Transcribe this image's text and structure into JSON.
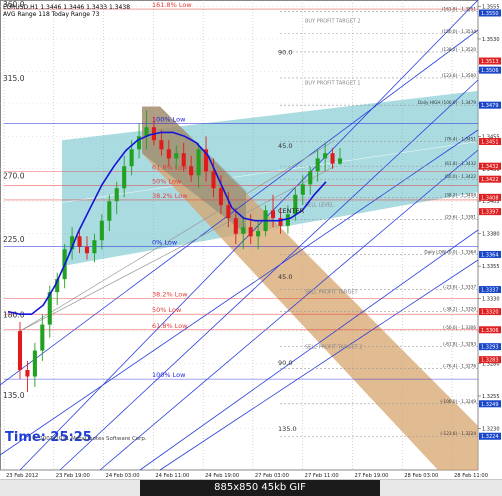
{
  "header": {
    "line1": "EURUSD,H1  1.3446 1.3446 1.3433 1.3438",
    "line2": "AVG Range 118   Today Range 73"
  },
  "footer": {
    "timer": "Time: 25:25",
    "copyright": "© 2001-2011 MetaQuotes Software Corp.",
    "image_caption": "885x850  45kb  GIF"
  },
  "colors": {
    "candle_up": "#21a121",
    "candle_down": "#e01b1b",
    "ma_line": "#1414d9",
    "up_channel": "#64bec8",
    "down_channel": "#d7a46e",
    "fib_red": "#e83a3a",
    "fib_gray": "#8c8c8c",
    "blue_label": "#2222dd",
    "price_tag_blue": "#1a47c9",
    "price_tag_red": "#e02020"
  },
  "chart_data": {
    "type": "candlestick",
    "symbol": "EURUSD",
    "timeframe": "H1",
    "ylim": [
      1.3198,
      1.356
    ],
    "x_ticks": [
      "23 Feb 2012",
      "23 Feb 19:00",
      "24 Feb 03:00",
      "24 Feb 11:00",
      "24 Feb 19:00",
      "27 Feb 03:00",
      "27 Feb 11:00",
      "27 Feb 19:00",
      "28 Feb 03:00",
      "28 Feb 11:00"
    ],
    "y_ticks": [
      "1.3555",
      "1.3530",
      "1.3505",
      "1.3480",
      "1.3455",
      "1.3430",
      "1.3405",
      "1.3380",
      "1.3355",
      "1.3330",
      "1.3305",
      "1.3280",
      "1.3255",
      "1.3230"
    ],
    "series": [
      {
        "name": "EURUSD",
        "values": [
          {
            "x": 0,
            "o": 1.3305,
            "h": 1.3312,
            "l": 1.3268,
            "c": 1.3275
          },
          {
            "x": 1,
            "o": 1.3275,
            "h": 1.3282,
            "l": 1.3258,
            "c": 1.327
          },
          {
            "x": 2,
            "o": 1.327,
            "h": 1.3296,
            "l": 1.3262,
            "c": 1.329
          },
          {
            "x": 3,
            "o": 1.329,
            "h": 1.3318,
            "l": 1.3282,
            "c": 1.331
          },
          {
            "x": 4,
            "o": 1.331,
            "h": 1.334,
            "l": 1.33,
            "c": 1.3335
          },
          {
            "x": 5,
            "o": 1.3335,
            "h": 1.335,
            "l": 1.3325,
            "c": 1.3345
          },
          {
            "x": 6,
            "o": 1.3345,
            "h": 1.3372,
            "l": 1.3338,
            "c": 1.3368
          },
          {
            "x": 7,
            "o": 1.3368,
            "h": 1.3385,
            "l": 1.336,
            "c": 1.3378
          },
          {
            "x": 8,
            "o": 1.3378,
            "h": 1.3382,
            "l": 1.3365,
            "c": 1.337
          },
          {
            "x": 9,
            "o": 1.337,
            "h": 1.3378,
            "l": 1.336,
            "c": 1.3365
          },
          {
            "x": 10,
            "o": 1.3365,
            "h": 1.338,
            "l": 1.3358,
            "c": 1.3375
          },
          {
            "x": 11,
            "o": 1.3375,
            "h": 1.3395,
            "l": 1.3368,
            "c": 1.339
          },
          {
            "x": 12,
            "o": 1.339,
            "h": 1.341,
            "l": 1.3382,
            "c": 1.3405
          },
          {
            "x": 13,
            "o": 1.3405,
            "h": 1.342,
            "l": 1.3395,
            "c": 1.3415
          },
          {
            "x": 14,
            "o": 1.3415,
            "h": 1.344,
            "l": 1.3408,
            "c": 1.3432
          },
          {
            "x": 15,
            "o": 1.3432,
            "h": 1.3452,
            "l": 1.3425,
            "c": 1.3445
          },
          {
            "x": 16,
            "o": 1.3445,
            "h": 1.3465,
            "l": 1.3438,
            "c": 1.3455
          },
          {
            "x": 17,
            "o": 1.3455,
            "h": 1.3475,
            "l": 1.3445,
            "c": 1.3462
          },
          {
            "x": 18,
            "o": 1.3462,
            "h": 1.347,
            "l": 1.3448,
            "c": 1.3452
          },
          {
            "x": 19,
            "o": 1.3452,
            "h": 1.346,
            "l": 1.344,
            "c": 1.3445
          },
          {
            "x": 20,
            "o": 1.3445,
            "h": 1.3452,
            "l": 1.3432,
            "c": 1.3438
          },
          {
            "x": 21,
            "o": 1.3438,
            "h": 1.3448,
            "l": 1.343,
            "c": 1.3442
          },
          {
            "x": 22,
            "o": 1.3442,
            "h": 1.345,
            "l": 1.3428,
            "c": 1.3432
          },
          {
            "x": 23,
            "o": 1.3432,
            "h": 1.344,
            "l": 1.342,
            "c": 1.3425
          },
          {
            "x": 24,
            "o": 1.3425,
            "h": 1.345,
            "l": 1.3415,
            "c": 1.3445
          },
          {
            "x": 25,
            "o": 1.3445,
            "h": 1.3455,
            "l": 1.342,
            "c": 1.3428
          },
          {
            "x": 26,
            "o": 1.3428,
            "h": 1.3438,
            "l": 1.3408,
            "c": 1.3415
          },
          {
            "x": 27,
            "o": 1.3415,
            "h": 1.3425,
            "l": 1.3395,
            "c": 1.3402
          },
          {
            "x": 28,
            "o": 1.3402,
            "h": 1.3412,
            "l": 1.3385,
            "c": 1.3392
          },
          {
            "x": 29,
            "o": 1.3392,
            "h": 1.34,
            "l": 1.3372,
            "c": 1.338
          },
          {
            "x": 30,
            "o": 1.338,
            "h": 1.3392,
            "l": 1.3368,
            "c": 1.3385
          },
          {
            "x": 31,
            "o": 1.3385,
            "h": 1.3395,
            "l": 1.3372,
            "c": 1.3378
          },
          {
            "x": 32,
            "o": 1.3378,
            "h": 1.339,
            "l": 1.3368,
            "c": 1.3382
          },
          {
            "x": 33,
            "o": 1.3382,
            "h": 1.3402,
            "l": 1.3378,
            "c": 1.3398
          },
          {
            "x": 34,
            "o": 1.3398,
            "h": 1.341,
            "l": 1.3385,
            "c": 1.3392
          },
          {
            "x": 35,
            "o": 1.3392,
            "h": 1.34,
            "l": 1.338,
            "c": 1.3386
          },
          {
            "x": 36,
            "o": 1.3386,
            "h": 1.3402,
            "l": 1.338,
            "c": 1.3395
          },
          {
            "x": 37,
            "o": 1.3395,
            "h": 1.3415,
            "l": 1.339,
            "c": 1.341
          },
          {
            "x": 38,
            "o": 1.341,
            "h": 1.3425,
            "l": 1.3402,
            "c": 1.3418
          },
          {
            "x": 39,
            "o": 1.3418,
            "h": 1.3432,
            "l": 1.341,
            "c": 1.3428
          },
          {
            "x": 40,
            "o": 1.3428,
            "h": 1.3445,
            "l": 1.342,
            "c": 1.3438
          },
          {
            "x": 41,
            "o": 1.3438,
            "h": 1.345,
            "l": 1.3428,
            "c": 1.3442
          },
          {
            "x": 42,
            "o": 1.3442,
            "h": 1.3446,
            "l": 1.343,
            "c": 1.3434
          },
          {
            "x": 43,
            "o": 1.3434,
            "h": 1.3446,
            "l": 1.3433,
            "c": 1.3438
          }
        ]
      },
      {
        "name": "MA",
        "values": [
          1.332,
          1.3318,
          1.3318,
          1.3325,
          1.334,
          1.336,
          1.3382,
          1.34,
          1.3418,
          1.3432,
          1.3444,
          1.3452,
          1.3456,
          1.3458,
          1.3458,
          1.3455,
          1.345,
          1.344,
          1.342,
          1.34,
          1.3392,
          1.339,
          1.339,
          1.339,
          1.3392,
          1.3398,
          1.341,
          1.342
        ]
      }
    ],
    "fib_levels_down": [
      {
        "label": "100% Low",
        "value": 1.3465,
        "color": "blue"
      },
      {
        "label": "61.8% Low",
        "value": 1.3428
      },
      {
        "label": "50% Low",
        "value": 1.3417
      },
      {
        "label": "38.2% Low",
        "value": 1.3406
      },
      {
        "label": "0% Low",
        "value": 1.337,
        "color": "blue"
      },
      {
        "label": "38.2% Low",
        "value": 1.333
      },
      {
        "label": "50% Low",
        "value": 1.3318
      },
      {
        "label": "61.8% Low",
        "value": 1.3306
      },
      {
        "label": "100% Low",
        "value": 1.3268,
        "color": "blue"
      },
      {
        "label": "161.8% Low",
        "value": 1.3553
      }
    ],
    "right_levels": [
      {
        "label": "(161.8) - 1.3551",
        "value": 1.3551
      },
      {
        "label": "(150.0) - 1.3534",
        "value": 1.3534
      },
      {
        "label": "(138.2) - 1.3520",
        "value": 1.352
      },
      {
        "label": "(123.6) - 1.3500",
        "value": 1.35
      },
      {
        "label": "Daily HIGH (100.0) - 1.3479",
        "value": 1.3479
      },
      {
        "label": "(76.4) - 1.3451",
        "value": 1.3451
      },
      {
        "label": "(61.8) - 1.3432",
        "value": 1.3432
      },
      {
        "label": "(50.0) - 1.3422",
        "value": 1.3422
      },
      {
        "label": "(38.2) - 1.3408",
        "value": 1.3408
      },
      {
        "label": "(23.6) - 1.3391",
        "value": 1.3391
      },
      {
        "label": "Daily LOW (0.0) - 1.3364",
        "value": 1.3364
      },
      {
        "label": "(-23.6) - 1.3337",
        "value": 1.3337
      },
      {
        "label": "(-38.2) - 1.3320",
        "value": 1.332
      },
      {
        "label": "(-50.0) - 1.3306",
        "value": 1.3306
      },
      {
        "label": "(-61.8) - 1.3293",
        "value": 1.3293
      },
      {
        "label": "(-76.4) - 1.3276",
        "value": 1.3276
      },
      {
        "label": "(-100.0) - 1.3249",
        "value": 1.3249
      },
      {
        "label": "(-123.6) - 1.3224",
        "value": 1.3224
      }
    ],
    "price_tags": [
      {
        "text": "1.3550",
        "value": 1.355,
        "color": "blue"
      },
      {
        "text": "1.3513",
        "value": 1.3513,
        "color": "red"
      },
      {
        "text": "1.3506",
        "value": 1.3506,
        "color": "blue"
      },
      {
        "text": "1.3479",
        "value": 1.3479,
        "color": "blue"
      },
      {
        "text": "1.3451",
        "value": 1.3451,
        "color": "red"
      },
      {
        "text": "1.3432",
        "value": 1.3432,
        "color": "red"
      },
      {
        "text": "1.3422",
        "value": 1.3422,
        "color": "red"
      },
      {
        "text": "1.3408",
        "value": 1.3408,
        "color": "red"
      },
      {
        "text": "1.3397",
        "value": 1.3397,
        "color": "red"
      },
      {
        "text": "1.3364",
        "value": 1.3364,
        "color": "blue"
      },
      {
        "text": "1.3337",
        "value": 1.3337,
        "color": "blue"
      },
      {
        "text": "1.3320",
        "value": 1.332,
        "color": "red"
      },
      {
        "text": "1.3306",
        "value": 1.3306,
        "color": "red"
      },
      {
        "text": "1.3293",
        "value": 1.3293,
        "color": "blue"
      },
      {
        "text": "1.3283",
        "value": 1.3283,
        "color": "red"
      },
      {
        "text": "1.3249",
        "value": 1.3249,
        "color": "blue"
      },
      {
        "text": "1.3224",
        "value": 1.3224,
        "color": "blue"
      }
    ],
    "target_labels": [
      {
        "text": "BUY PROFIT TARGET 2",
        "value": 1.3542
      },
      {
        "text": "BUY PROFIT TARGET 1",
        "value": 1.3494
      },
      {
        "text": "SELL LEVEL",
        "value": 1.34
      },
      {
        "text": "SELL PROFIT TARGET",
        "value": 1.3333
      },
      {
        "text": "SELL PROFIT TARGET 2",
        "value": 1.3291
      }
    ],
    "center_label": "CENTER",
    "gann_angles": [
      "360.0",
      "315.0",
      "270.0",
      "225.0",
      "180.0",
      "135.0"
    ],
    "gann_angle_values": [
      1.3553,
      1.3496,
      1.3421,
      1.3372,
      1.3314,
      1.3252
    ],
    "mid_angles": [
      {
        "text": "90.0",
        "value": 1.3518
      },
      {
        "text": "45.0",
        "value": 1.3446
      },
      {
        "text": "45.0",
        "value": 1.3345
      },
      {
        "text": "90.0",
        "value": 1.3279
      },
      {
        "text": "135.0",
        "value": 1.3228
      }
    ]
  }
}
